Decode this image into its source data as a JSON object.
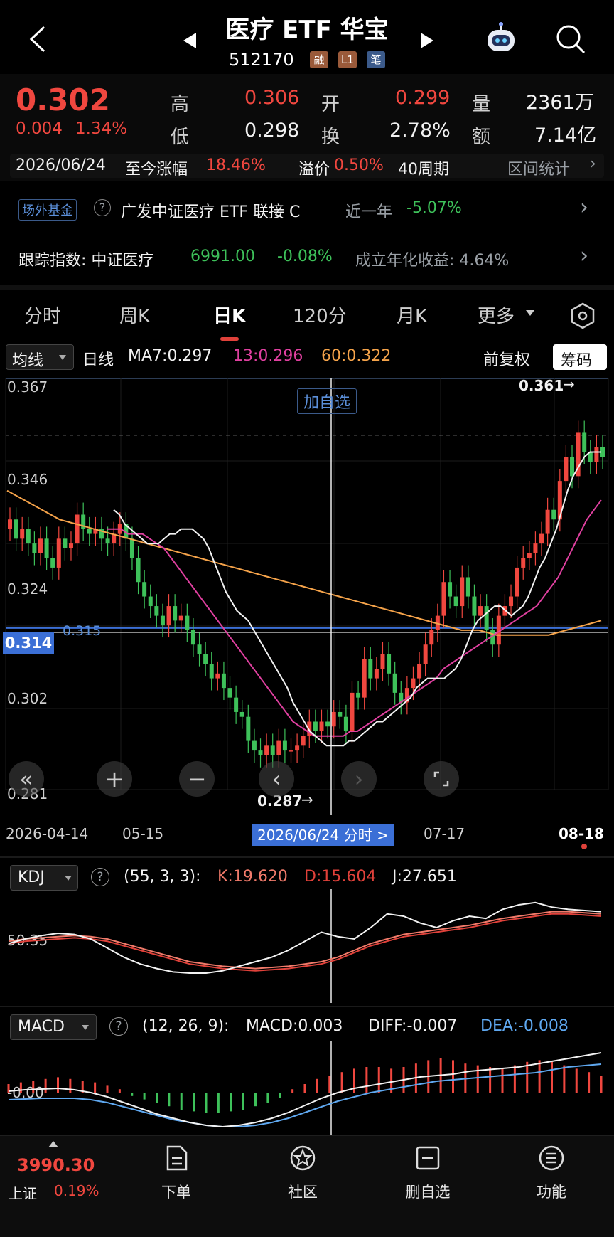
{
  "header": {
    "title": "医疗 ETF 华宝",
    "code": "512170",
    "tags": [
      {
        "label": "融",
        "color": "#9a5a3a"
      },
      {
        "label": "L1",
        "color": "#9a5a3a"
      },
      {
        "label": "笔",
        "color": "#3b5a8a"
      }
    ]
  },
  "quote": {
    "price": "0.302",
    "change": "0.004",
    "change_pct": "1.34%",
    "high_label": "高",
    "high": "0.306",
    "open_label": "开",
    "open": "0.299",
    "vol_label": "量",
    "vol": "2361万",
    "low_label": "低",
    "low": "0.298",
    "turn_label": "换",
    "turn": "2.78%",
    "amt_label": "额",
    "amt": "7.14亿"
  },
  "period_row": {
    "date": "2026/06/24",
    "since_label": "至今涨幅",
    "since_value": "18.46%",
    "premium_label": "溢价",
    "premium_value": "0.50%",
    "weeks": "40周期",
    "stats_label": "区间统计"
  },
  "fund_row": {
    "badge": "场外基金",
    "name": "广发中证医疗 ETF 联接 C",
    "period": "近一年",
    "value": "-5.07%"
  },
  "index_row": {
    "label": "跟踪指数: 中证医疗",
    "value": "6991.00",
    "change": "-0.08%",
    "annual": "成立年化收益: 4.64%"
  },
  "tabs": [
    "分时",
    "周K",
    "日K",
    "120分",
    "月K",
    "更多"
  ],
  "active_tab": "日K",
  "ma": {
    "selector": "均线",
    "period": "日线",
    "ma7": "MA7:0.297",
    "ma13": "13:0.296",
    "ma60": "60:0.322",
    "adjust": "前复权",
    "chips": "筹码"
  },
  "chart_data": {
    "type": "candlestick",
    "y_ticks": [
      "0.367",
      "0.346",
      "0.324",
      "0.302",
      "0.281"
    ],
    "ylim": [
      0.281,
      0.367
    ],
    "current_price_label": "0.314",
    "ref_line_label": "0.315",
    "high_marker": "0.361",
    "low_marker": "0.287",
    "add_watch": "加自选",
    "x_ticks": [
      "2026-04-14",
      "05-15",
      "07-17",
      "08-18"
    ],
    "crosshair_date": "2026/06/24 分时 >",
    "closes": [
      0.338,
      0.334,
      0.336,
      0.333,
      0.331,
      0.334,
      0.33,
      0.328,
      0.334,
      0.332,
      0.333,
      0.339,
      0.336,
      0.335,
      0.336,
      0.334,
      0.333,
      0.335,
      0.337,
      0.334,
      0.33,
      0.325,
      0.322,
      0.32,
      0.318,
      0.316,
      0.32,
      0.317,
      0.318,
      0.315,
      0.312,
      0.31,
      0.308,
      0.305,
      0.306,
      0.303,
      0.301,
      0.298,
      0.297,
      0.292,
      0.29,
      0.289,
      0.291,
      0.289,
      0.292,
      0.29,
      0.29,
      0.291,
      0.293,
      0.296,
      0.294,
      0.296,
      0.295,
      0.298,
      0.297,
      0.294,
      0.302,
      0.301,
      0.309,
      0.305,
      0.307,
      0.31,
      0.306,
      0.302,
      0.3,
      0.303,
      0.305,
      0.308,
      0.312,
      0.315,
      0.318,
      0.325,
      0.322,
      0.32,
      0.326,
      0.322,
      0.318,
      0.32,
      0.315,
      0.312,
      0.318,
      0.32,
      0.322,
      0.328,
      0.33,
      0.331,
      0.333,
      0.335,
      0.34,
      0.338,
      0.346,
      0.351,
      0.347,
      0.356,
      0.352,
      0.35,
      0.353,
      0.351
    ],
    "ma7": [
      0.34,
      0.339,
      0.337,
      0.336,
      0.335,
      0.334,
      0.333,
      0.333,
      0.333,
      0.334,
      0.335,
      0.335,
      0.336,
      0.336,
      0.336,
      0.335,
      0.334,
      0.332,
      0.329,
      0.326,
      0.323,
      0.321,
      0.319,
      0.318,
      0.317,
      0.315,
      0.313,
      0.311,
      0.309,
      0.307,
      0.305,
      0.303,
      0.3,
      0.298,
      0.296,
      0.294,
      0.293,
      0.292,
      0.291,
      0.291,
      0.291,
      0.291,
      0.292,
      0.292,
      0.293,
      0.294,
      0.295,
      0.296,
      0.296,
      0.297,
      0.298,
      0.299,
      0.3,
      0.301,
      0.303,
      0.304,
      0.305,
      0.305,
      0.305,
      0.305,
      0.306,
      0.307,
      0.309,
      0.312,
      0.315,
      0.317,
      0.318,
      0.319,
      0.32,
      0.32,
      0.319,
      0.318,
      0.319,
      0.32,
      0.322,
      0.325,
      0.328,
      0.33,
      0.333,
      0.336,
      0.34,
      0.344,
      0.347,
      0.349,
      0.351,
      0.352,
      0.352,
      0.352
    ],
    "ma13": [
      0.336,
      0.336,
      0.336,
      0.335,
      0.335,
      0.335,
      0.334,
      0.333,
      0.332,
      0.33,
      0.328,
      0.326,
      0.324,
      0.322,
      0.32,
      0.318,
      0.316,
      0.314,
      0.312,
      0.31,
      0.308,
      0.306,
      0.304,
      0.302,
      0.3,
      0.298,
      0.296,
      0.295,
      0.294,
      0.293,
      0.293,
      0.293,
      0.293,
      0.293,
      0.294,
      0.294,
      0.295,
      0.296,
      0.297,
      0.298,
      0.299,
      0.3,
      0.301,
      0.302,
      0.303,
      0.304,
      0.305,
      0.307,
      0.308,
      0.309,
      0.31,
      0.311,
      0.312,
      0.313,
      0.314,
      0.315,
      0.316,
      0.317,
      0.318,
      0.319,
      0.32,
      0.322,
      0.324,
      0.326,
      0.329,
      0.332,
      0.335,
      0.338,
      0.34,
      0.342
    ],
    "ma60": [
      0.344,
      0.342,
      0.34,
      0.338,
      0.337,
      0.336,
      0.335,
      0.334,
      0.333,
      0.332,
      0.331,
      0.33,
      0.329,
      0.328,
      0.327,
      0.326,
      0.325,
      0.324,
      0.323,
      0.322,
      0.321,
      0.32,
      0.319,
      0.318,
      0.317,
      0.316,
      0.315,
      0.315,
      0.314,
      0.314,
      0.314,
      0.314,
      0.315,
      0.316,
      0.317
    ]
  },
  "kdj": {
    "label": "KDJ",
    "params": "(55, 3, 3):",
    "k": "K:19.620",
    "d": "D:15.604",
    "j": "J:27.651",
    "level": "50.35",
    "k_series": [
      48,
      50,
      51,
      52,
      53,
      52,
      50,
      46,
      42,
      38,
      34,
      30,
      28,
      26,
      25,
      24,
      25,
      26,
      28,
      30,
      34,
      40,
      46,
      50,
      54,
      56,
      58,
      60,
      62,
      65,
      68,
      70,
      72,
      74,
      74,
      73,
      72
    ],
    "j_series": [
      46,
      50,
      53,
      55,
      54,
      50,
      42,
      34,
      28,
      24,
      21,
      20,
      20,
      22,
      26,
      30,
      34,
      40,
      48,
      56,
      52,
      50,
      60,
      72,
      70,
      64,
      60,
      66,
      70,
      68,
      76,
      80,
      82,
      78,
      76,
      75,
      74
    ]
  },
  "macd": {
    "label": "MACD",
    "params": "(12, 26, 9):",
    "macd": "MACD:0.003",
    "diff": "DIFF:-0.007",
    "dea": "DEA:-0.008",
    "level": "-0.00",
    "hist": [
      0.5,
      0.6,
      0.7,
      0.8,
      0.9,
      0.8,
      0.7,
      0.6,
      0.4,
      0.2,
      -0.2,
      -0.4,
      -0.6,
      -0.8,
      -1.0,
      -1.1,
      -1.2,
      -1.2,
      -1.1,
      -1.0,
      -0.8,
      -0.6,
      -0.3,
      0.2,
      0.5,
      0.8,
      1.0,
      1.2,
      1.4,
      1.5,
      1.5,
      1.4,
      1.5,
      1.7,
      1.9,
      2.0,
      1.9,
      1.7,
      1.6,
      1.5,
      1.4,
      1.6,
      1.8,
      1.9,
      1.8,
      1.6,
      1.4,
      1.2,
      1.0
    ]
  },
  "bottom": {
    "index_value": "3990.30",
    "index_name": "上证",
    "index_change": "0.19%",
    "nav": [
      "下单",
      "社区",
      "删自选",
      "功能"
    ]
  }
}
